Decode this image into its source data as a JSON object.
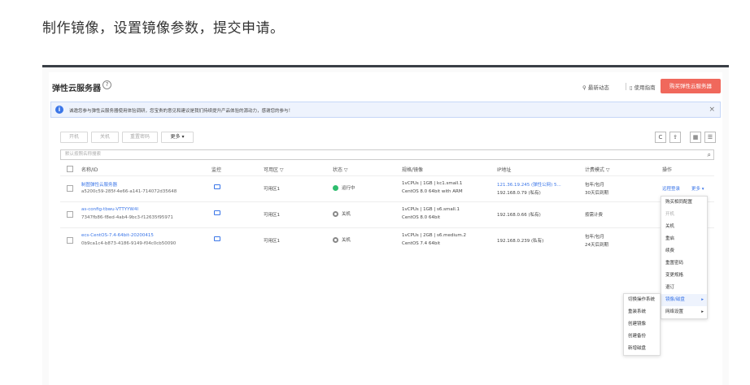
{
  "instruction": "制作镜像，设置镜像参数，提交申请。",
  "header": {
    "title": "弹性云服务器",
    "help": "?",
    "link_news": "最新动态",
    "link_guide": "使用指南",
    "buy_button": "购买弹性云服务器"
  },
  "notice": {
    "text": "诚邀您参与弹性云服务器使用体验调研，您宝贵的意见和建议是我们持续提升产品体验的源动力，感谢您的参与！",
    "close": "×"
  },
  "toolbar": {
    "start": "开机",
    "stop": "关机",
    "reset_password": "重置密码",
    "more": "更多 ▾",
    "icons": [
      "C",
      "⇪",
      "▦",
      "☰"
    ]
  },
  "search": {
    "placeholder": "默认按照名称搜索",
    "icon": "search-icon"
  },
  "table": {
    "headers": [
      "名称/ID",
      "监控",
      "可用区 ▽",
      "状态 ▽",
      "规格/镜像",
      "IP地址",
      "计费模式 ▽",
      "操作"
    ],
    "rows": [
      {
        "name": "制图弹性云服务器",
        "id": "a5200c59-285f-4e66-a141-714072d35648",
        "zone": "可用区1",
        "status": "运行中",
        "spec": "1vCPUs | 1GB | kc1.small.1",
        "image": "CentOS 8.0 64bit with ARM",
        "ip1": "121.36.19.245 (弹性公网) 5...",
        "ip2": "192.168.0.79 (私有)",
        "billing1": "包年/包月",
        "billing2": "30天后到期",
        "op_remote": "远程登录",
        "op_more": "更多 ▾"
      },
      {
        "name": "as-config-tbwu-VTTYYW4I",
        "id": "7347fb86-f8ed-4ab4-9bc3-f12635f95971",
        "zone": "可用区1",
        "status": "关机",
        "spec": "1vCPUs | 1GB | s6.small.1",
        "image": "CentOS 8.0 64bit",
        "ip1": "192.168.0.66 (私有)",
        "ip2": "",
        "billing1": "按需计费",
        "billing2": ""
      },
      {
        "name": "ecs-CentOS-7.4-64bit-20200415",
        "id": "0b9ca1c4-b873-4186-9149-f04c0cb50090",
        "zone": "可用区1",
        "status": "关机",
        "spec": "1vCPUs | 2GB | s6.medium.2",
        "image": "CentOS 7.4 64bit",
        "ip1": "192.168.0.239 (私有)",
        "ip2": "",
        "billing1": "包年/包月",
        "billing2": "24天后到期"
      }
    ]
  },
  "more_menu": {
    "items": [
      "购买相同配置",
      "开机",
      "关机",
      "重启",
      "续费",
      "重置密码",
      "变更规格",
      "退订",
      "镜像/磁盘",
      "网络设置"
    ]
  },
  "sub_menu": {
    "items": [
      "切换操作系统",
      "重装系统",
      "创建镜像",
      "创建备份",
      "新增磁盘"
    ]
  }
}
